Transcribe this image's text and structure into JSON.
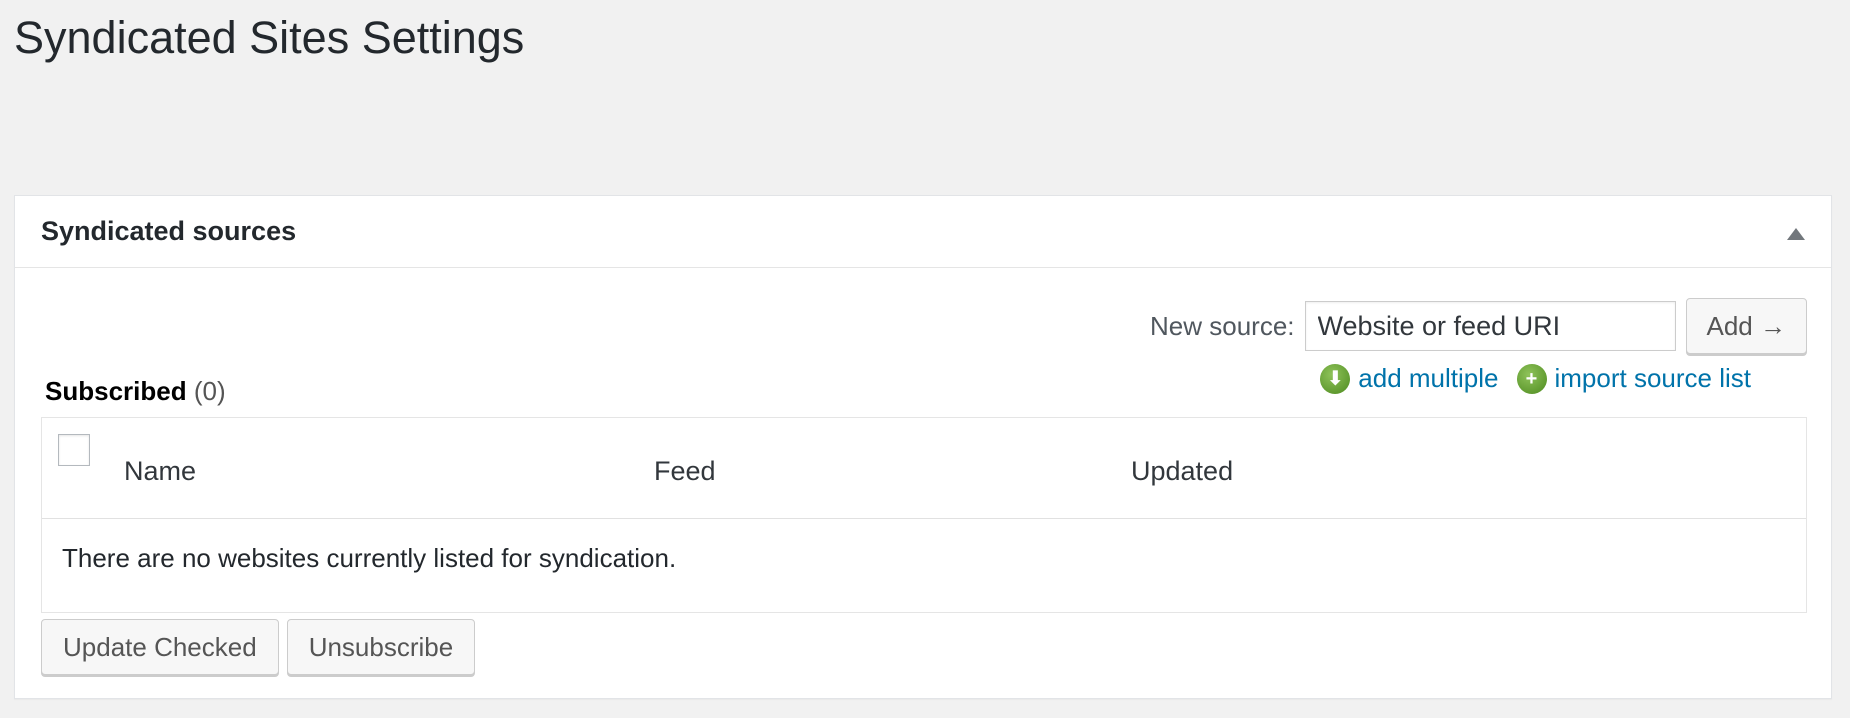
{
  "page": {
    "title": "Syndicated Sites Settings"
  },
  "postbox": {
    "title": "Syndicated sources",
    "toggle_icon": "triangle-up-icon"
  },
  "new_source": {
    "label": "New source:",
    "value": "Website or feed URI",
    "placeholder": "Website or feed URI",
    "add_label": "Add →"
  },
  "links": {
    "add_multiple": {
      "label": "add multiple",
      "icon": "green-arrow-down-icon",
      "glyph": "⬇"
    },
    "import_source_list": {
      "label": "import source list",
      "icon": "green-plus-icon",
      "glyph": "+"
    }
  },
  "subscribed": {
    "label": "Subscribed",
    "count": "(0)"
  },
  "table": {
    "columns": [
      "Name",
      "Feed",
      "Updated"
    ],
    "empty_message": "There are no websites currently listed for syndication."
  },
  "actions": {
    "update_checked": "Update Checked",
    "unsubscribe": "Unsubscribe"
  },
  "colors": {
    "link": "#0073aa",
    "background": "#f1f1f1",
    "icon_green": "#5a9a2a"
  }
}
